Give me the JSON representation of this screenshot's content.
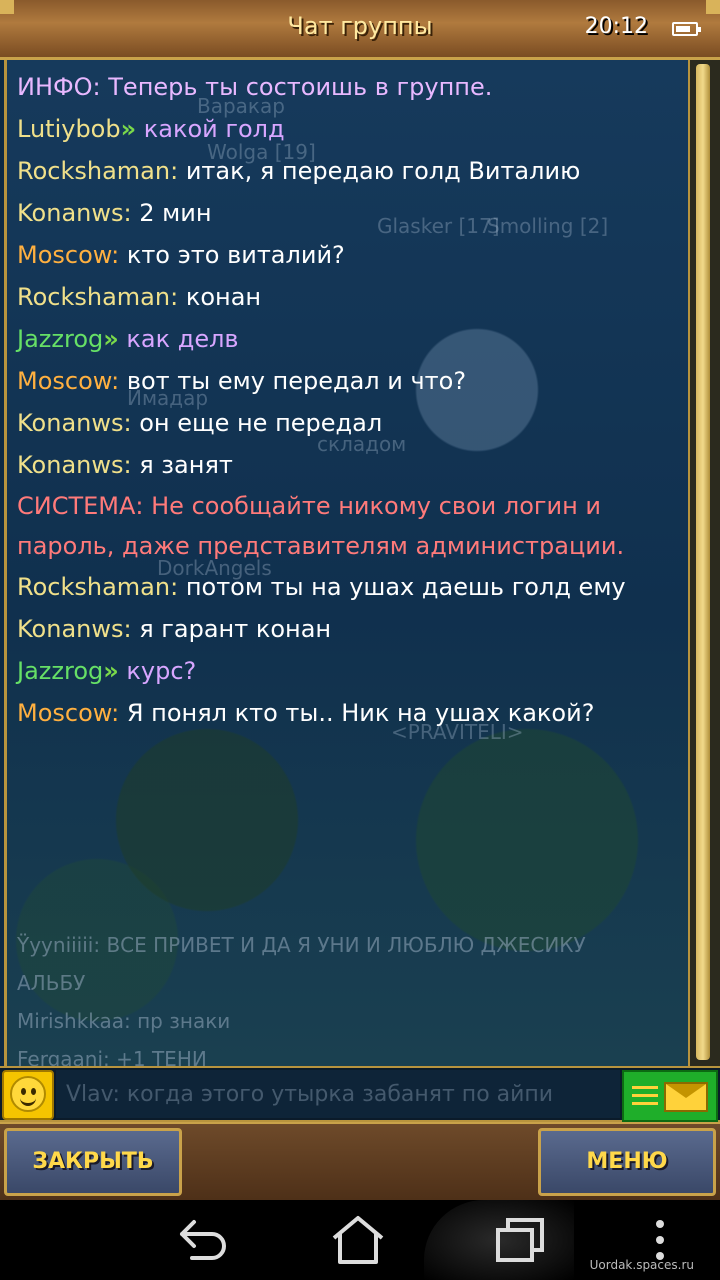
{
  "window": {
    "title": "Чат группы",
    "clock": "20:12"
  },
  "chat": {
    "messages": [
      {
        "text": "ИНФО: Теперь ты состоишь в группе."
      },
      {
        "sender": "Lutiybob",
        "text": "какой голд"
      },
      {
        "sender": "Rockshaman:",
        "text": "итак, я передаю голд Виталию"
      },
      {
        "sender": "Konanws:",
        "text": "2 мин"
      },
      {
        "sender": "Moscow:",
        "text": "кто это виталий?"
      },
      {
        "sender": "Rockshaman:",
        "text": "конан"
      },
      {
        "sender": "Jazzrog",
        "text": "как делв"
      },
      {
        "sender": "Moscow:",
        "text": "вот ты ему передал и что?"
      },
      {
        "sender": "Konanws:",
        "text": "он еще не передал"
      },
      {
        "sender": "Konanws:",
        "text": "я занят"
      },
      {
        "text": "СИСТЕМА: Не сообщайте никому свои логин и пароль, даже представителям администрации."
      },
      {
        "sender": "Rockshaman:",
        "text": "потом ты на ушах даешь голд ему"
      },
      {
        "sender": "Konanws:",
        "text": "я гарант конан"
      },
      {
        "sender": "Jazzrog",
        "text": "курс?"
      },
      {
        "sender": "Moscow:",
        "text": "Я понял кто ты.. Ник на ушах какой?"
      }
    ],
    "background_chat": [
      "Ÿyyniiiii: ВСЕ ПРИВЕТ И ДА Я УНИ И ЛЮБЛЮ ДЖЕСИКУ",
      "АЛЬБУ",
      "Mirishkkaa: пр знаки",
      "Fergaani: +1 ТЕНИ"
    ],
    "map_labels": [
      "Варакар",
      "Wolga [19]",
      "Glasker [17]",
      "Smolling [2]",
      "<PRAVITELI>",
      "складом",
      "DorkAngels",
      "Имадар"
    ]
  },
  "input": {
    "placeholder": "Vlav: когда этого утырка забанят по айпи"
  },
  "buttons": {
    "close": "ЗАКРЫТЬ",
    "menu": "МЕНЮ"
  },
  "watermark": "Uordak.spaces.ru",
  "colors": {
    "sender_yellow": "#f0e08a",
    "sender_orange": "#ffb040",
    "sender_green": "#66e066",
    "text_purple": "#d8a6ff",
    "system_red": "#ff7a7a",
    "button_text": "#ffd84a"
  }
}
